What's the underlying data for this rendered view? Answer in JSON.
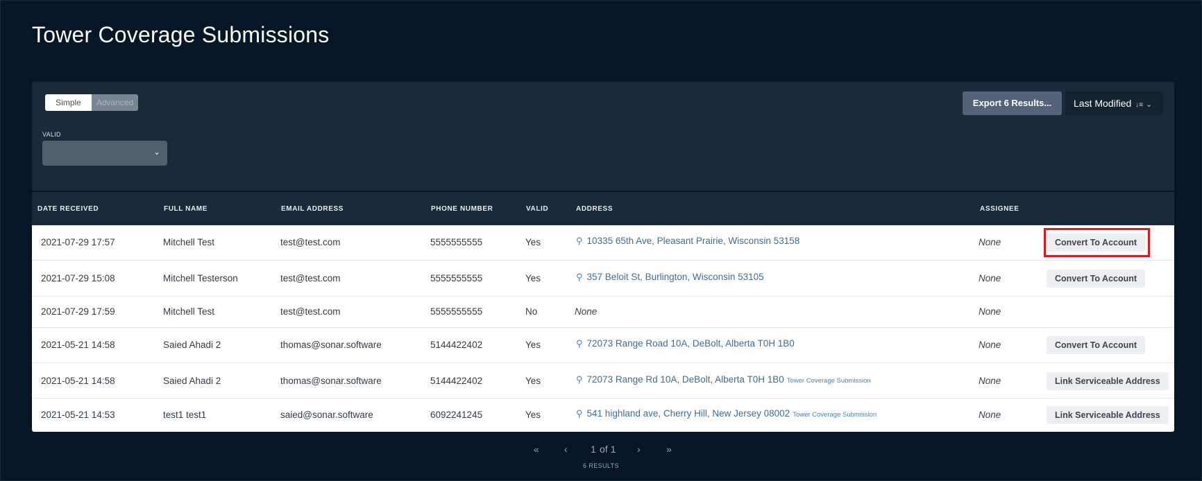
{
  "page": {
    "title": "Tower Coverage Submissions"
  },
  "filters": {
    "mode_simple": "Simple",
    "mode_advanced": "Advanced",
    "valid_label": "VALID",
    "valid_value": ""
  },
  "toolbar": {
    "export_label": "Export 6 Results...",
    "sort_label": "Last Modified"
  },
  "table": {
    "headers": [
      "DATE RECEIVED",
      "FULL NAME",
      "EMAIL ADDRESS",
      "PHONE NUMBER",
      "VALID",
      "ADDRESS",
      "ASSIGNEE"
    ],
    "rows": [
      {
        "date": "2021-07-29 17:57",
        "name": "Mitchell Test",
        "email": "test@test.com",
        "phone": "5555555555",
        "valid": "Yes",
        "address": "10335 65th Ave, Pleasant Prairie, Wisconsin 53158",
        "address_tag": "",
        "assignee": "None",
        "action": "Convert To Account"
      },
      {
        "date": "2021-07-29 15:08",
        "name": "Mitchell Testerson",
        "email": "test@test.com",
        "phone": "5555555555",
        "valid": "Yes",
        "address": "357 Beloit St, Burlington, Wisconsin 53105",
        "address_tag": "",
        "assignee": "None",
        "action": "Convert To Account"
      },
      {
        "date": "2021-07-29 17:59",
        "name": "Mitchell Test",
        "email": "test@test.com",
        "phone": "5555555555",
        "valid": "No",
        "address": "None",
        "address_tag": "",
        "assignee": "None",
        "action": ""
      },
      {
        "date": "2021-05-21 14:58",
        "name": "Saied Ahadi 2",
        "email": "thomas@sonar.software",
        "phone": "5144422402",
        "valid": "Yes",
        "address": "72073 Range Road 10A, DeBolt, Alberta T0H 1B0",
        "address_tag": "",
        "assignee": "None",
        "action": "Convert To Account"
      },
      {
        "date": "2021-05-21 14:58",
        "name": "Saied Ahadi 2",
        "email": "thomas@sonar.software",
        "phone": "5144422402",
        "valid": "Yes",
        "address": "72073 Range Rd 10A, DeBolt, Alberta T0H 1B0",
        "address_tag": "Tower Coverage Submission",
        "assignee": "None",
        "action": "Link Serviceable Address"
      },
      {
        "date": "2021-05-21 14:53",
        "name": "test1 test1",
        "email": "saied@sonar.software",
        "phone": "6092241245",
        "valid": "Yes",
        "address": "541 highland ave, Cherry Hill, New Jersey 08002",
        "address_tag": "Tower Coverage Submission",
        "assignee": "None",
        "action": "Link Serviceable Address"
      }
    ]
  },
  "pagination": {
    "first": "«",
    "prev": "‹",
    "current": "1",
    "of_label": "of 1",
    "next": "›",
    "last": "»",
    "results_label": "6 RESULTS"
  }
}
